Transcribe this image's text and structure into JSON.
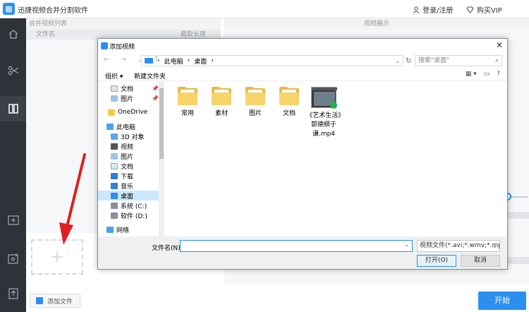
{
  "app": {
    "title": "迅捷视频合并分割软件",
    "login": "登录/注册",
    "vip": "购买VIP",
    "accent": "#2b8ff0"
  },
  "merge_panel": {
    "header": "合并视频列表",
    "col_name": "文件名",
    "col_length": "截取长度",
    "add_file": "添加文件"
  },
  "preview_panel": {
    "header": "视频展示",
    "start": "开始"
  },
  "dialog": {
    "title": "添加视频",
    "breadcrumb": [
      "此电脑",
      "桌面"
    ],
    "search_placeholder": "搜索\"桌面\"",
    "organize": "组织 ▾",
    "new_folder": "新建文件夹",
    "tree": [
      "文档",
      "图片",
      "OneDrive",
      "此电脑",
      "3D 对象",
      "视频",
      "图片",
      "文档",
      "下载",
      "音乐",
      "桌面",
      "系统 (C:)",
      "软件 (D:)",
      "网络"
    ],
    "files": [
      "常用",
      "素材",
      "图片",
      "文档"
    ],
    "video_file": "《艺术生活》郭德纲于谦.mp4",
    "filename_label": "文件名(N):",
    "filetype": "视频文件(*.avi;*.wmv;*.mp4;*.",
    "open": "打开(O)",
    "cancel": "取消"
  }
}
